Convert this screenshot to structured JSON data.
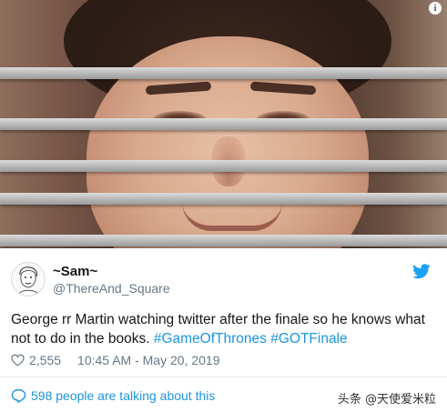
{
  "photo": {
    "info_glyph": "i"
  },
  "tweet": {
    "display_name": "~Sam~",
    "handle": "@ThereAnd_Square",
    "text_plain": "George rr Martin watching twitter after the finale so he knows what not to do in the books. ",
    "hashtags": [
      "#GameOfThrones",
      "#GOTFinale"
    ],
    "likes": "2,555",
    "timestamp": "10:45 AM - May 20, 2019",
    "talking": "598 people are talking about this",
    "icons": {
      "platform": "bird-icon",
      "like": "heart-icon",
      "talk": "speech-bubble-icon",
      "info": "info-icon"
    }
  },
  "watermark": "头条 @天使爱米粒",
  "colors": {
    "link": "#1b95e0",
    "muted": "#657786",
    "text": "#14171a"
  }
}
